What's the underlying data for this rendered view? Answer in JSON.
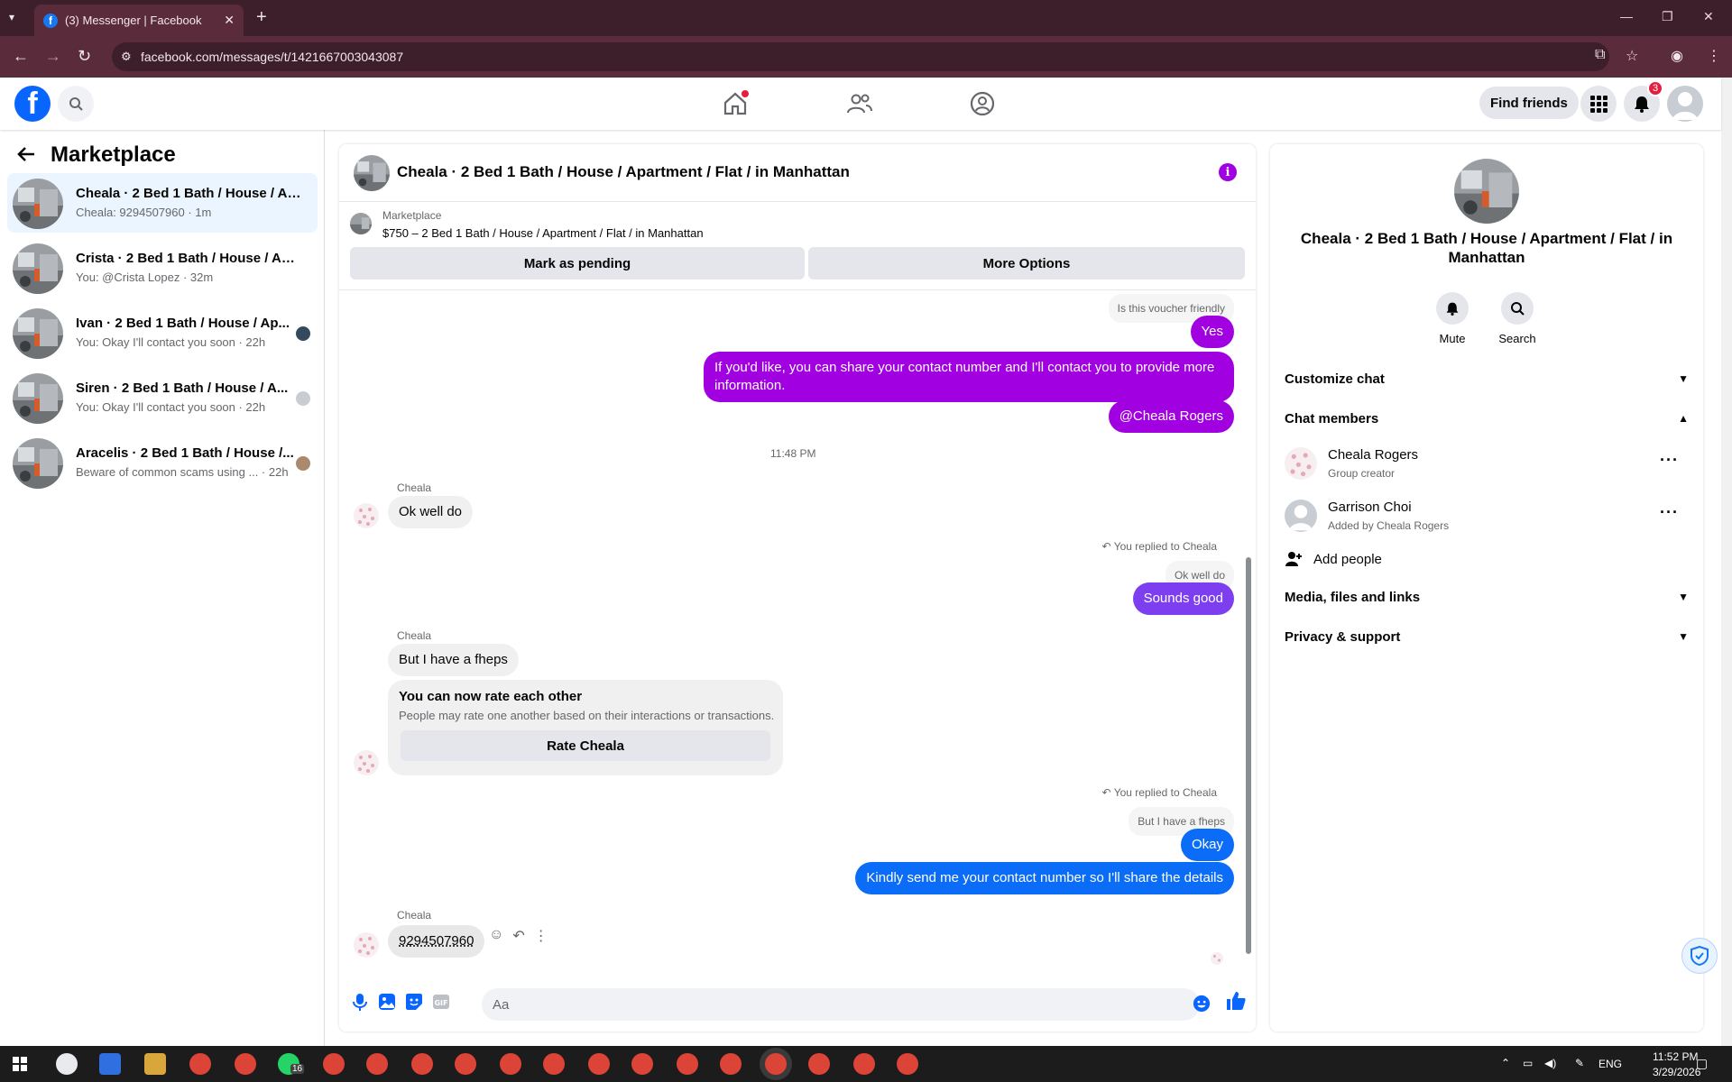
{
  "browser": {
    "tab_title": "(3) Messenger | Facebook",
    "url": "facebook.com/messages/t/1421667003043087"
  },
  "header": {
    "find_friends": "Find friends",
    "notification_count": "3"
  },
  "sidebar": {
    "title": "Marketplace",
    "conversations": [
      {
        "name": "Cheala · 2 Bed 1 Bath / House / Ap...",
        "preview": "Cheala: 9294507960 · 1m"
      },
      {
        "name": "Crista · 2 Bed 1 Bath / House / Apa...",
        "preview": "You: @Crista Lopez · 32m"
      },
      {
        "name": "Ivan · 2 Bed 1 Bath / House / Ap...",
        "preview": "You: Okay I'll contact you soon · 22h"
      },
      {
        "name": "Siren · 2 Bed 1 Bath / House / A...",
        "preview": "You: Okay I'll contact you soon · 22h"
      },
      {
        "name": "Aracelis · 2 Bed 1 Bath / House /...",
        "preview": "Beware of common scams using ... · 22h"
      }
    ]
  },
  "chat": {
    "title": "Cheala · 2 Bed 1 Bath / House / Apartment / Flat / in Manhattan",
    "marketplace_label": "Marketplace",
    "listing": "$750 – 2 Bed 1 Bath / House / Apartment / Flat / in Manhattan",
    "mark_pending": "Mark as pending",
    "more_options": "More Options",
    "messages": {
      "voucher_quote": "Is this voucher friendly",
      "yes": "Yes",
      "share_line1": "If you'd like, you can share your contact number and I'll contact you to provide more",
      "share_line2": "information.",
      "mention": "@Cheala Rogers",
      "time": "11:48 PM",
      "sender": "Cheala",
      "ok_well_do": "Ok well do",
      "replied_to": "You replied to Cheala",
      "quote_ok": "Ok well do",
      "sounds_good": "Sounds good",
      "fheps": "But I have a fheps",
      "rate_title": "You can now rate each other",
      "rate_sub": "People may rate one another based on their interactions or transactions.",
      "rate_btn": "Rate Cheala",
      "quote_fheps": "But I have a fheps",
      "okay": "Okay",
      "kindly": "Kindly send me your contact number so I'll share the details",
      "number": "9294507960"
    },
    "composer_placeholder": "Aa"
  },
  "details": {
    "title": "Cheala · 2 Bed 1 Bath / House / Apartment / Flat / in Manhattan",
    "mute": "Mute",
    "search": "Search",
    "customize": "Customize chat",
    "members_heading": "Chat members",
    "members": [
      {
        "name": "Cheala Rogers",
        "sub": "Group creator"
      },
      {
        "name": "Garrison Choi",
        "sub": "Added by Cheala Rogers"
      }
    ],
    "add_people": "Add people",
    "media": "Media, files and links",
    "privacy": "Privacy & support"
  },
  "taskbar": {
    "lang": "ENG",
    "time": "11:52 PM",
    "date": "3/29/2026",
    "whatsapp_badge": "16"
  },
  "colors": {
    "fb_blue": "#0866ff",
    "purple": "#a100e0",
    "violet": "#7d3ef0",
    "blue": "#0a6cf7"
  }
}
